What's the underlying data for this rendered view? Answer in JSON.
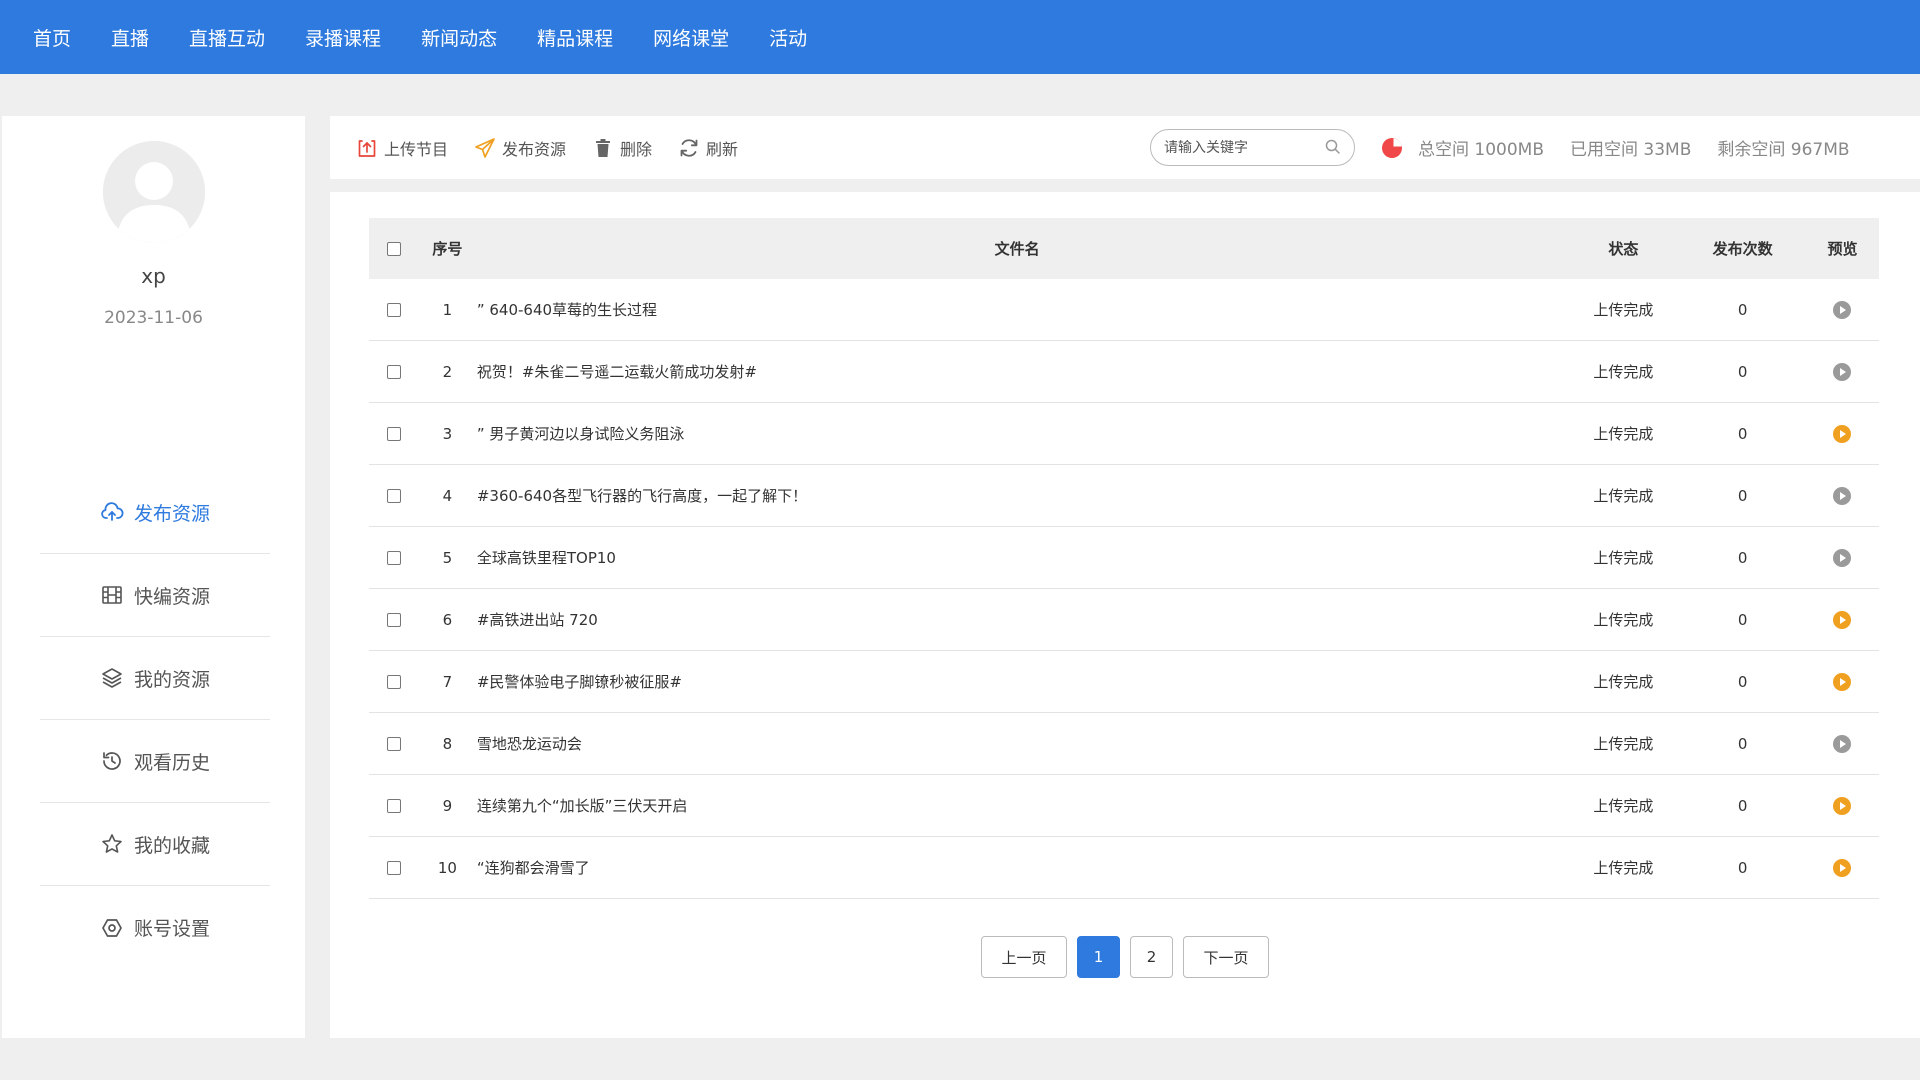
{
  "nav": {
    "items": [
      "首页",
      "直播",
      "直播互动",
      "录播课程",
      "新闻动态",
      "精品课程",
      "网络课堂",
      "活动"
    ]
  },
  "profile": {
    "username": "xp",
    "date": "2023-11-06"
  },
  "sidebar": {
    "items": [
      {
        "label": "发布资源",
        "icon": "cloud-upload-icon"
      },
      {
        "label": "快编资源",
        "icon": "film-grid-icon"
      },
      {
        "label": "我的资源",
        "icon": "layers-icon"
      },
      {
        "label": "观看历史",
        "icon": "history-icon"
      },
      {
        "label": "我的收藏",
        "icon": "star-icon"
      },
      {
        "label": "账号设置",
        "icon": "settings-hexagon-icon"
      }
    ]
  },
  "toolbar": {
    "upload": "上传节目",
    "publish": "发布资源",
    "delete": "删除",
    "refresh": "刷新"
  },
  "search": {
    "placeholder": "请输入关键字"
  },
  "storage": {
    "total": "总空间 1000MB",
    "used": "已用空间 33MB",
    "remaining": "剩余空间 967MB",
    "used_fraction": 0.033
  },
  "table": {
    "headers": {
      "no": "序号",
      "name": "文件名",
      "status": "状态",
      "count": "发布次数",
      "preview": "预览"
    },
    "rows": [
      {
        "no": "1",
        "name": "” 640-640草莓的生长过程",
        "status": "上传完成",
        "count": "0",
        "preview": "gray"
      },
      {
        "no": "2",
        "name": "祝贺！#朱雀二号遥二运载火箭成功发射#",
        "status": "上传完成",
        "count": "0",
        "preview": "gray"
      },
      {
        "no": "3",
        "name": "” 男子黄河边以身试险义务阻泳",
        "status": "上传完成",
        "count": "0",
        "preview": "orange"
      },
      {
        "no": "4",
        "name": "#360-640各型飞行器的飞行高度，一起了解下！",
        "status": "上传完成",
        "count": "0",
        "preview": "gray"
      },
      {
        "no": "5",
        "name": "全球高铁里程TOP10",
        "status": "上传完成",
        "count": "0",
        "preview": "gray"
      },
      {
        "no": "6",
        "name": "#高铁进出站 720",
        "status": "上传完成",
        "count": "0",
        "preview": "orange"
      },
      {
        "no": "7",
        "name": "#民警体验电子脚镣秒被征服#",
        "status": "上传完成",
        "count": "0",
        "preview": "orange"
      },
      {
        "no": "8",
        "name": "雪地恐龙运动会",
        "status": "上传完成",
        "count": "0",
        "preview": "gray"
      },
      {
        "no": "9",
        "name": "连续第九个“加长版”三伏天开启",
        "status": "上传完成",
        "count": "0",
        "preview": "orange"
      },
      {
        "no": "10",
        "name": "“连狗都会滑雪了",
        "status": "上传完成",
        "count": "0",
        "preview": "orange"
      }
    ]
  },
  "pagination": {
    "prev": "上一页",
    "pages": [
      "1",
      "2"
    ],
    "current": "1",
    "next": "下一页"
  },
  "colors": {
    "brand": "#2e7ade",
    "preview_active": "#f0a020",
    "preview_inactive": "#9a9a9a",
    "storage_pie": "#f04848"
  }
}
